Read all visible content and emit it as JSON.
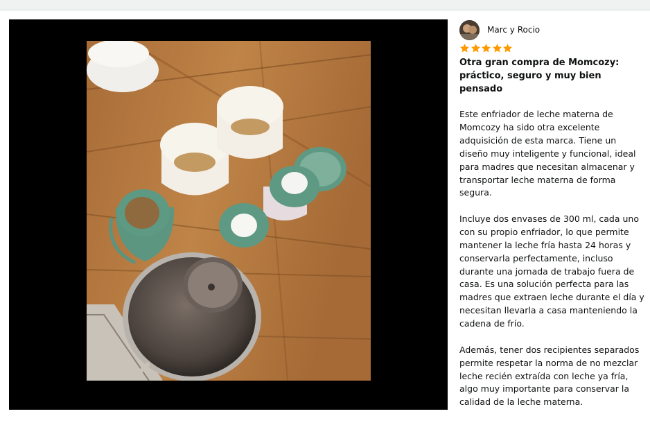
{
  "reviewer": {
    "name": "Marc y Rocio"
  },
  "rating": {
    "stars": 5,
    "max": 5,
    "color": "#ff9900"
  },
  "review": {
    "title": "Otra gran compra de Momcozy: práctico, seguro y muy bien pensado",
    "paragraphs": [
      "Este enfriador de leche materna de Momcozy ha sido otra excelente adquisición de esta marca. Tiene un diseño muy inteligente y funcional, ideal para madres que necesitan almacenar y transportar leche materna de forma segura.",
      "Incluye dos envases de 300 ml, cada uno con su propio enfriador, lo que permite mantener la leche fría hasta 24 horas y conservarla perfectamente, incluso durante una jornada de trabajo fuera de casa. Es una solución perfecta para las madres que extraen leche durante el día y necesitan llevarla a casa manteniendo la cadena de frío.",
      "Además, tener dos recipientes separados permite respetar la norma de no mezclar leche recién extraída con leche ya fría, algo muy importante para conservar la calidad de la leche materna."
    ]
  },
  "colors": {
    "viewer_background": "#000000",
    "text": "#0f1111",
    "star": "#ff9900"
  }
}
